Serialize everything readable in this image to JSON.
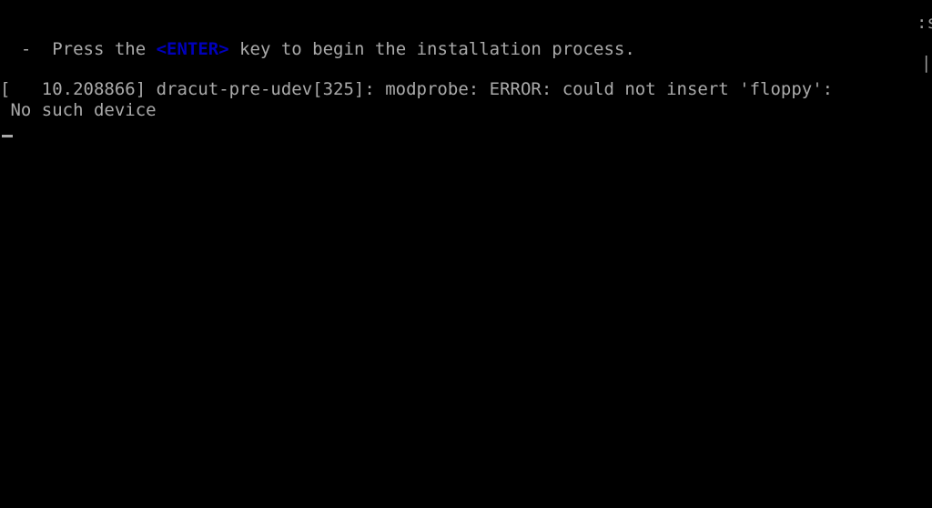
{
  "screen": {
    "kind": "linux-boot-console",
    "background_color": "#000000",
    "foreground_color": "#aaaaaa",
    "accent_color": "#0000bb",
    "cursor_color": "#aaaaaa",
    "columns": 85,
    "rows": 25
  },
  "console": {
    "prompt_line": {
      "before_key": "  -  Press the ",
      "key_token": "<ENTER>",
      "after_key": " key to begin the installation process."
    },
    "log_line_1": "[   10.208866] dracut-pre-udev[325]: modprobe: ERROR: could not insert 'floppy':",
    "log_line_2": " No such device",
    "edge_fragment_top": ":s",
    "edge_fragment_mid": "|]",
    "cursor": "_"
  }
}
